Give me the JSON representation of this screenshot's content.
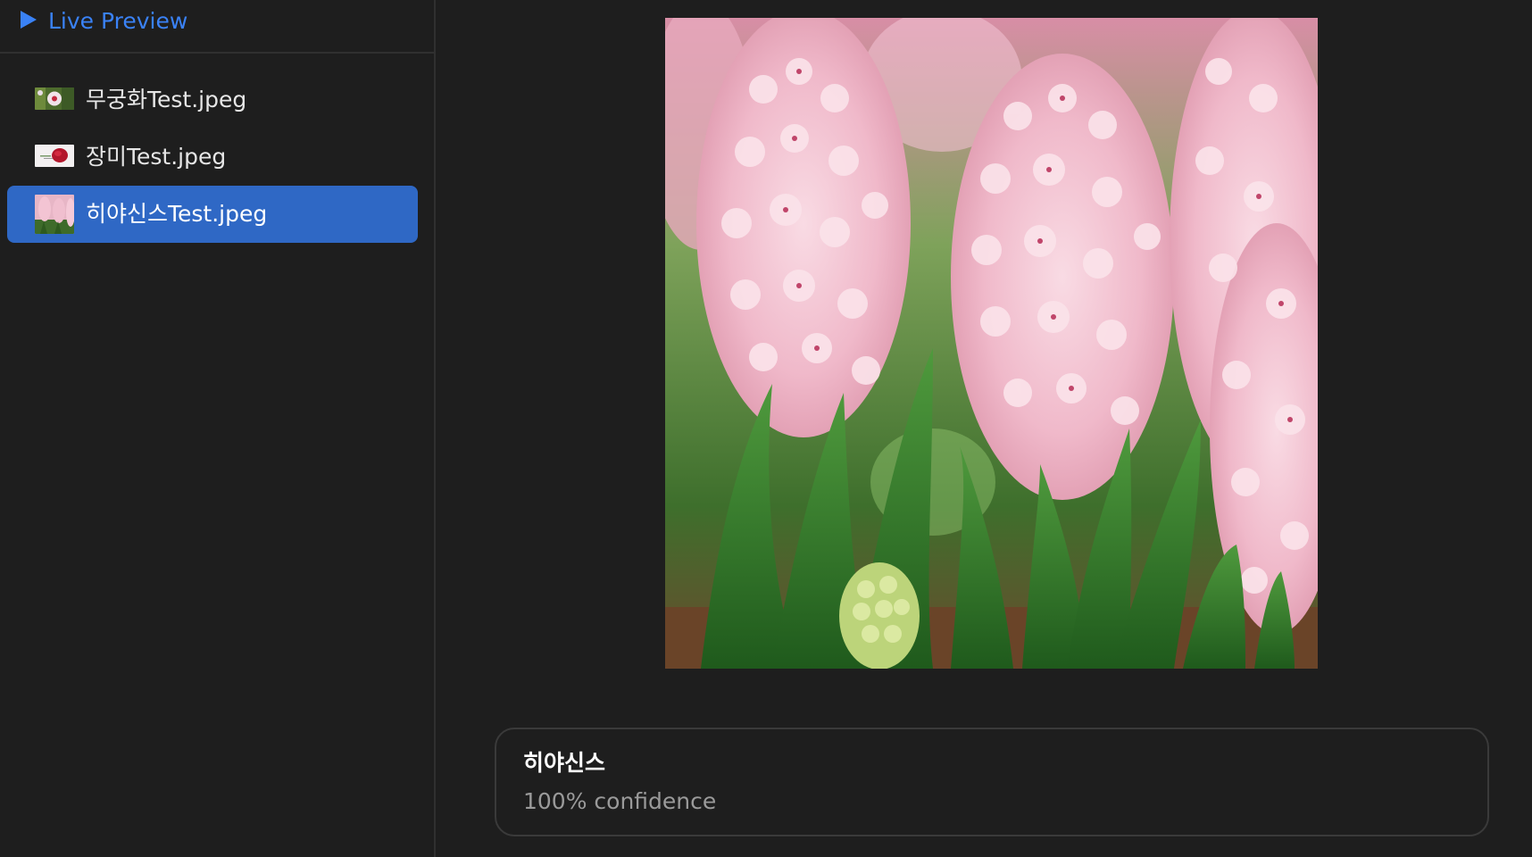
{
  "sidebar": {
    "header": {
      "title": "Live Preview",
      "icon": "play-icon",
      "accent_color": "#3a82f6"
    },
    "files": [
      {
        "name": "무궁화Test.jpeg",
        "thumbnail": "hibiscus-flower-thumbnail",
        "selected": false
      },
      {
        "name": "장미Test.jpeg",
        "thumbnail": "rose-flower-thumbnail",
        "selected": false
      },
      {
        "name": "히야신스Test.jpeg",
        "thumbnail": "hyacinth-flower-thumbnail",
        "selected": true
      }
    ],
    "selection_color": "#2f68c5"
  },
  "main": {
    "preview": {
      "subject": "pink hyacinth flowers"
    },
    "result": {
      "label": "히야신스",
      "confidence": "100% confidence"
    }
  }
}
